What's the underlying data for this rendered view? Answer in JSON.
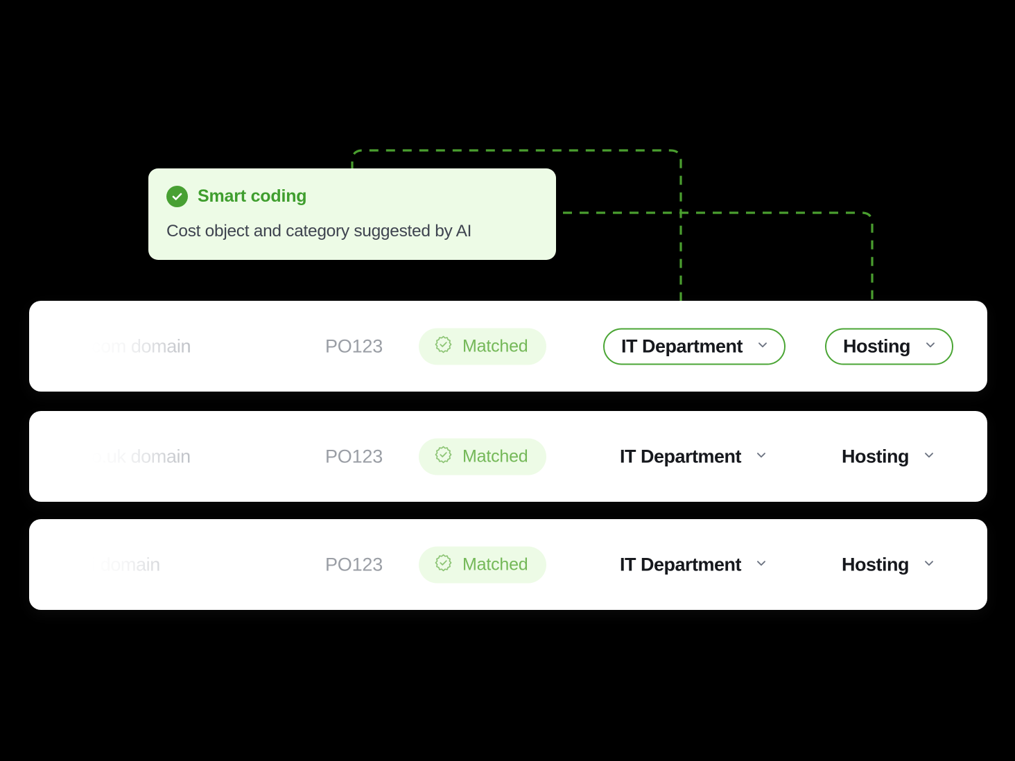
{
  "theme": {
    "background": "#000000",
    "accent_green": "#4aa534",
    "badge_green": "#74b858",
    "callout_bg": "#edfbe6",
    "title_green": "#3f9e2e",
    "row_bg": "#ffffff",
    "muted_text": "#9a9ea5",
    "faded_text": "#b9bcc2",
    "dark_text": "#16181d"
  },
  "callout": {
    "icon": "check-circle-icon",
    "title": "Smart coding",
    "subtitle": "Cost object and category suggested by AI"
  },
  "rows": [
    {
      "description": "com domain",
      "po_number": "PO123",
      "status": {
        "icon": "rosette-check-icon",
        "label": "Matched"
      },
      "cost_object": {
        "label": "IT Department",
        "icon": "chevron-down-icon",
        "highlighted": true
      },
      "category": {
        "label": "Hosting",
        "icon": "chevron-down-icon",
        "highlighted": true
      }
    },
    {
      "description": "o.uk domain",
      "po_number": "PO123",
      "status": {
        "icon": "rosette-check-icon",
        "label": "Matched"
      },
      "cost_object": {
        "label": "IT Department",
        "icon": "chevron-down-icon",
        "highlighted": false
      },
      "category": {
        "label": "Hosting",
        "icon": "chevron-down-icon",
        "highlighted": false
      }
    },
    {
      "description": "i domain",
      "po_number": "PO123",
      "status": {
        "icon": "rosette-check-icon",
        "label": "Matched"
      },
      "cost_object": {
        "label": "IT Department",
        "icon": "chevron-down-icon",
        "highlighted": false
      },
      "category": {
        "label": "Hosting",
        "icon": "chevron-down-icon",
        "highlighted": false
      }
    }
  ],
  "connectors": [
    {
      "name": "callout-to-cost-object",
      "color": "#4a9e2f"
    },
    {
      "name": "callout-to-category",
      "color": "#4a9e2f"
    }
  ]
}
